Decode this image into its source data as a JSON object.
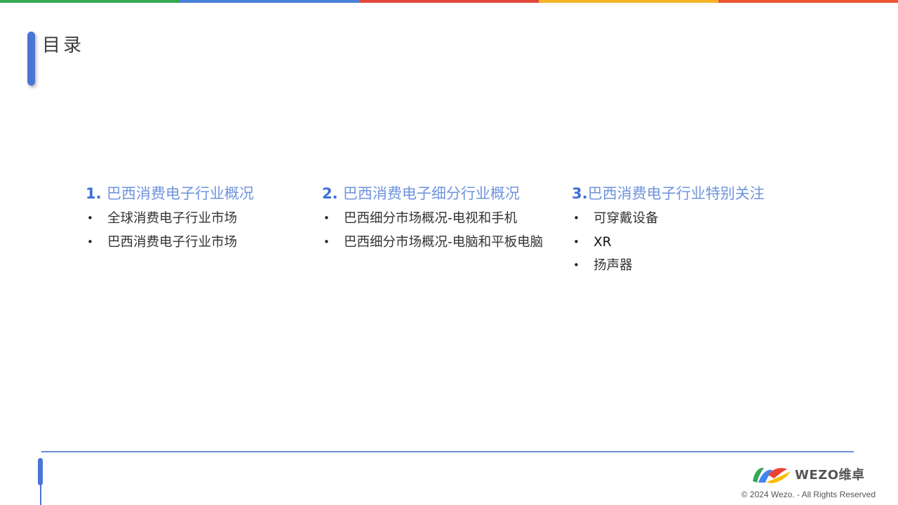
{
  "top_bar": {
    "colors": [
      "#36a853",
      "#4a7fd6",
      "#e2463a",
      "#f5b325",
      "#ea5730"
    ]
  },
  "title": "目录",
  "bullet_glyph": "•",
  "sections": [
    {
      "number": "1. ",
      "heading": "巴西消费电子行业概况",
      "items": [
        "全球消费电子行业市场",
        "巴西消费电子行业市场"
      ]
    },
    {
      "number": "2. ",
      "heading": "巴西消费电子细分行业概况",
      "items": [
        "巴西细分市场概况-电视和手机",
        "巴西细分市场概况-电脑和平板电脑"
      ]
    },
    {
      "number": "3.",
      "heading": "巴西消费电子行业特别关注",
      "items": [
        "可穿戴设备",
        "XR",
        "扬声器"
      ]
    }
  ],
  "footer": {
    "logo_icon": "wezo-swoosh-icon",
    "logo_text": "WEZO维卓",
    "copyright": "© 2024 Wezo. - All Rights Reserved"
  },
  "theme": {
    "accent": "#4a74d6",
    "heading": "#6f93dd",
    "number": "#3c6fd6",
    "body_text": "#333333"
  }
}
